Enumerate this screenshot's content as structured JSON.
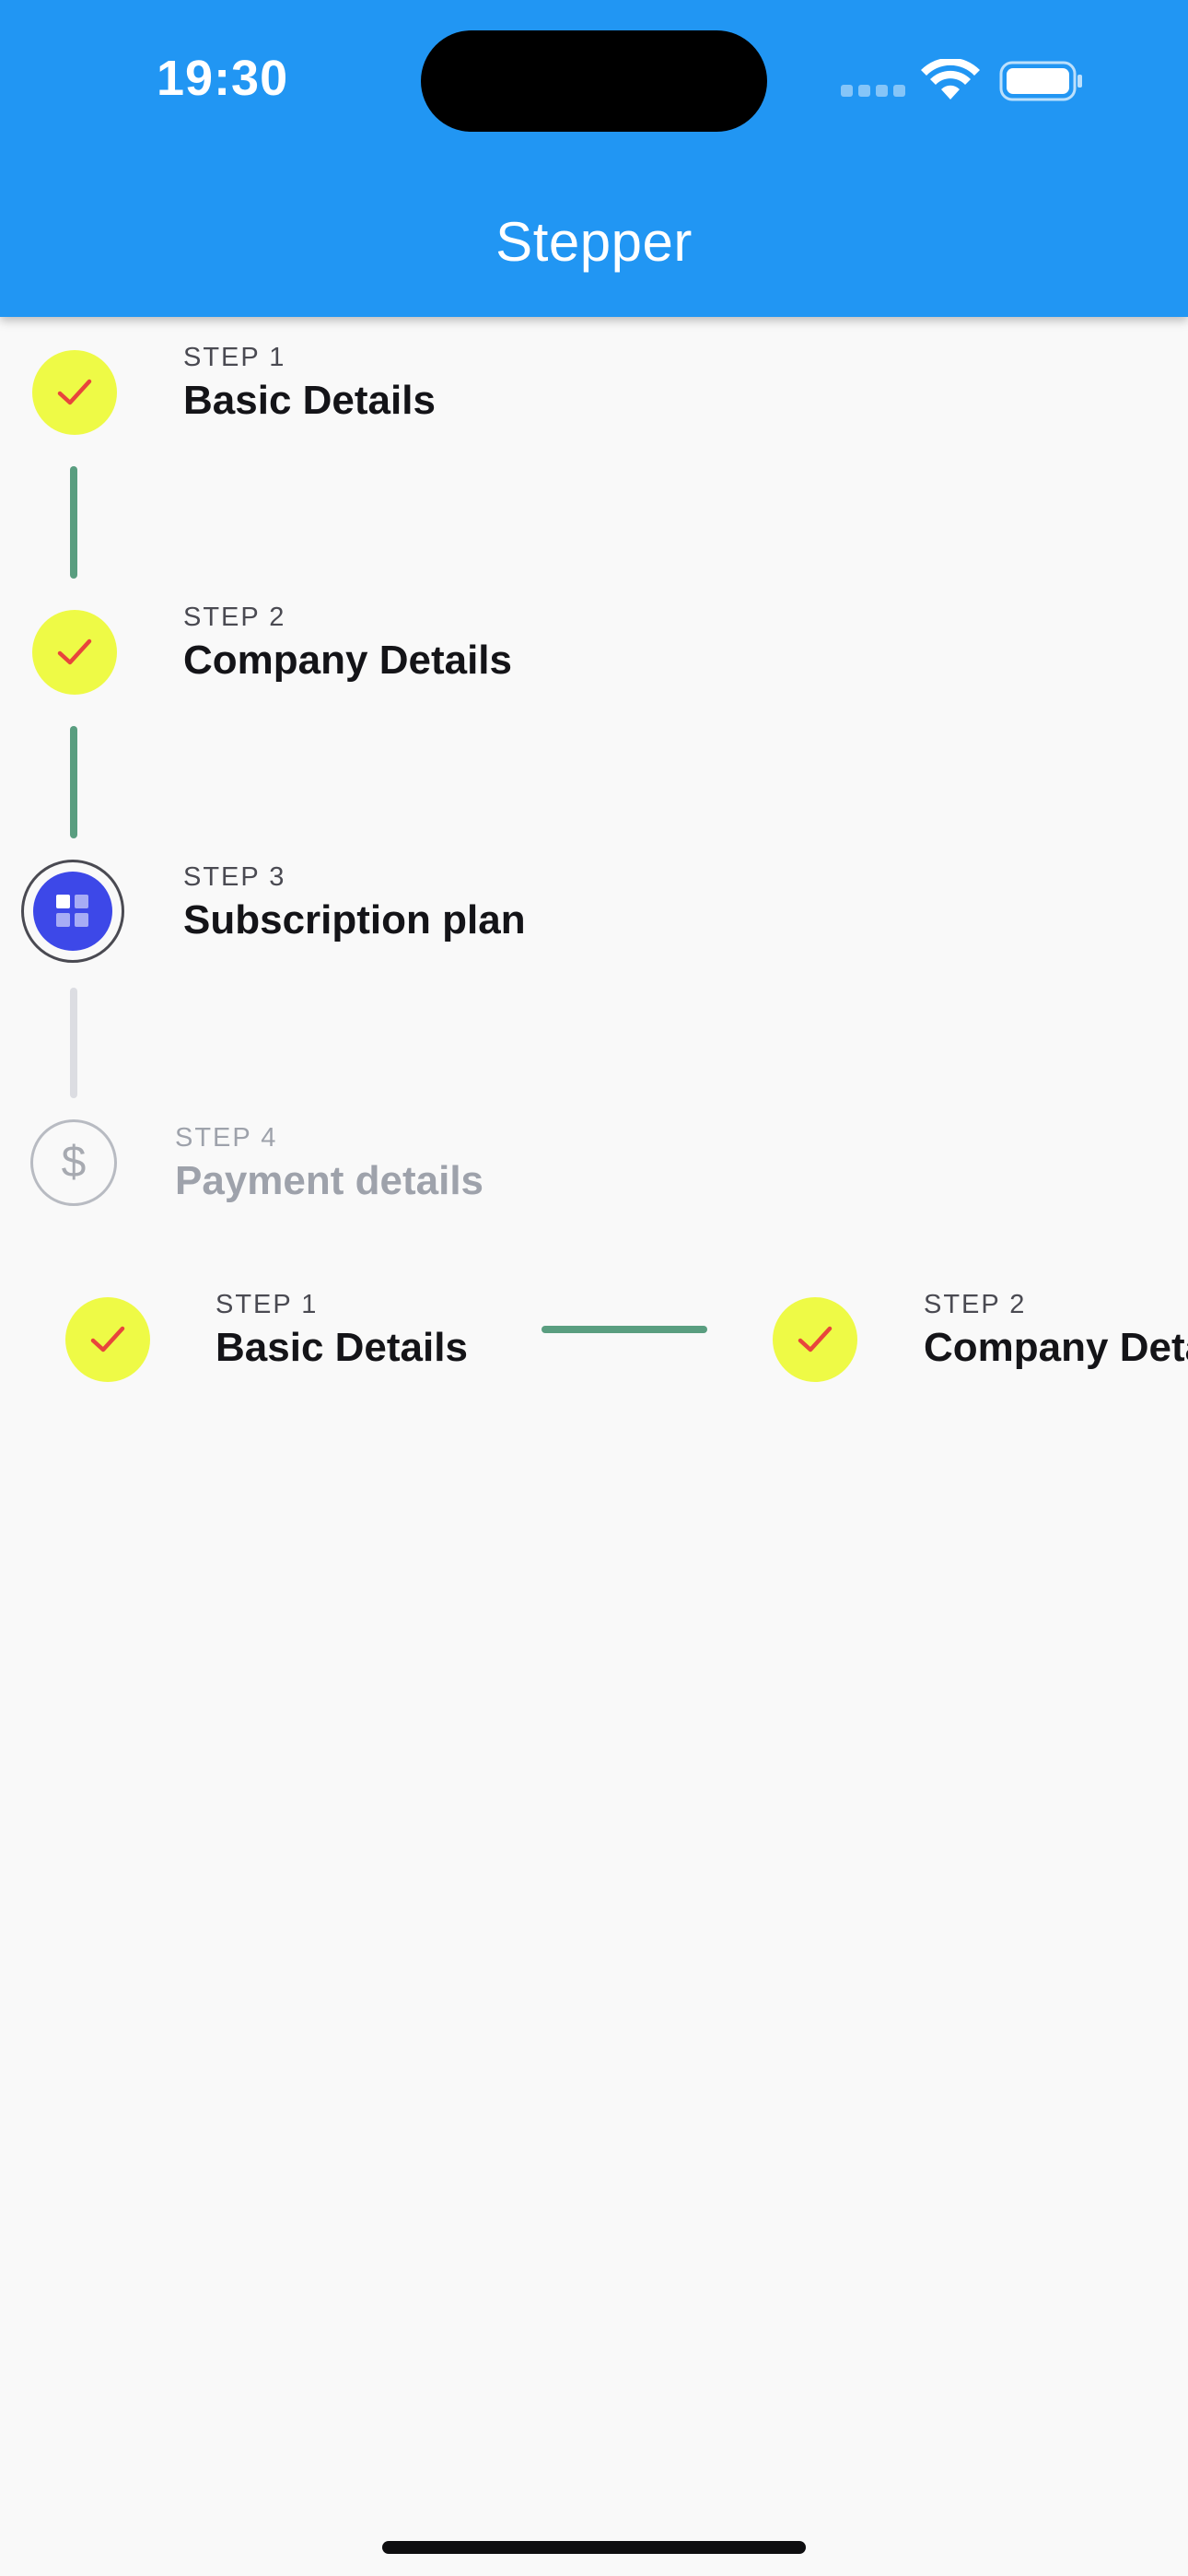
{
  "status_bar": {
    "time": "19:30"
  },
  "app_bar": {
    "title": "Stepper"
  },
  "colors": {
    "app_bar": "#2196f3",
    "done_circle": "#eefa46",
    "check_mark": "#e8453c",
    "done_connector": "#5a9e80",
    "active_step": "#3d48e8",
    "pending_connector": "#dcdde2",
    "background": "#f9f9f9"
  },
  "vertical_stepper": {
    "steps": [
      {
        "label": "STEP 1",
        "title": "Basic Details",
        "state": "completed",
        "icon": "check-icon"
      },
      {
        "label": "STEP 2",
        "title": "Company Details",
        "state": "completed",
        "icon": "check-icon"
      },
      {
        "label": "STEP 3",
        "title": "Subscription plan",
        "state": "active",
        "icon": "grid-icon"
      },
      {
        "label": "STEP 4",
        "title": "Payment details",
        "state": "pending",
        "icon": "dollar-icon",
        "icon_text": "$"
      }
    ]
  },
  "horizontal_stepper": {
    "steps": [
      {
        "label": "STEP 1",
        "title": "Basic Details",
        "state": "completed",
        "icon": "check-icon"
      },
      {
        "label": "STEP 2",
        "title": "Company Details",
        "state": "completed",
        "icon": "check-icon"
      }
    ]
  }
}
